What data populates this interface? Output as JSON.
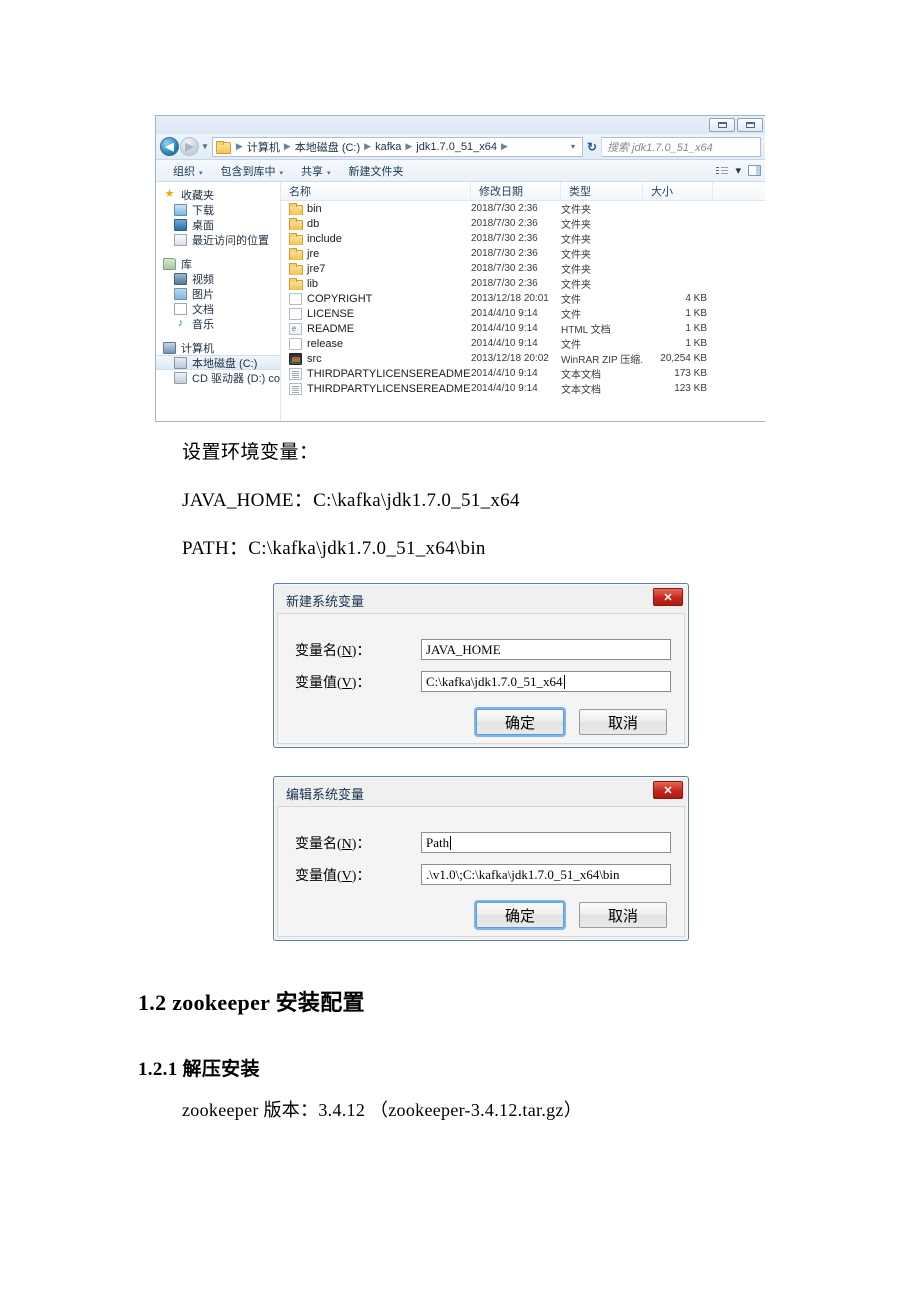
{
  "explorer": {
    "window_buttons": [
      "minimize-button",
      "maximize-button"
    ],
    "address": {
      "back_label": "◀",
      "forward_label": "▶",
      "breadcrumbs": [
        "计算机",
        "本地磁盘 (C:)",
        "kafka",
        "jdk1.7.0_51_x64"
      ],
      "dropdown_label": "▾",
      "refresh_label": "↻",
      "search_placeholder": "搜索 jdk1.7.0_51_x64"
    },
    "toolbar": {
      "items": [
        {
          "label": "组织",
          "caret": "▾"
        },
        {
          "label": "包含到库中",
          "caret": "▾"
        },
        {
          "label": "共享",
          "caret": "▾"
        },
        {
          "label": "新建文件夹",
          "caret": ""
        }
      ],
      "view_caret": "▾"
    },
    "nav": {
      "groups": [
        {
          "header": {
            "label": "收藏夹",
            "icon": "star-icon"
          },
          "children": [
            {
              "label": "下载",
              "icon": "downloads-icon"
            },
            {
              "label": "桌面",
              "icon": "desktop-icon"
            },
            {
              "label": "最近访问的位置",
              "icon": "recent-places-icon"
            }
          ]
        },
        {
          "header": {
            "label": "库",
            "icon": "library-icon"
          },
          "children": [
            {
              "label": "视频",
              "icon": "videos-icon"
            },
            {
              "label": "图片",
              "icon": "pictures-icon"
            },
            {
              "label": "文档",
              "icon": "documents-icon"
            },
            {
              "label": "音乐",
              "icon": "music-icon"
            }
          ]
        },
        {
          "header": {
            "label": "计算机",
            "icon": "computer-icon"
          },
          "children": [
            {
              "label": "本地磁盘 (C:)",
              "icon": "local-disk-icon",
              "selected": true
            },
            {
              "label": "CD 驱动器 (D:) con",
              "icon": "cd-drive-icon"
            }
          ]
        }
      ]
    },
    "columns": [
      "名称",
      "修改日期",
      "类型",
      "大小"
    ],
    "files": [
      {
        "name": "bin",
        "date": "2018/7/30 2:36",
        "type": "文件夹",
        "size": "",
        "icon": "folder-icon"
      },
      {
        "name": "db",
        "date": "2018/7/30 2:36",
        "type": "文件夹",
        "size": "",
        "icon": "folder-icon"
      },
      {
        "name": "include",
        "date": "2018/7/30 2:36",
        "type": "文件夹",
        "size": "",
        "icon": "folder-icon"
      },
      {
        "name": "jre",
        "date": "2018/7/30 2:36",
        "type": "文件夹",
        "size": "",
        "icon": "folder-icon"
      },
      {
        "name": "jre7",
        "date": "2018/7/30 2:36",
        "type": "文件夹",
        "size": "",
        "icon": "folder-icon"
      },
      {
        "name": "lib",
        "date": "2018/7/30 2:36",
        "type": "文件夹",
        "size": "",
        "icon": "folder-icon"
      },
      {
        "name": "COPYRIGHT",
        "date": "2013/12/18 20:01",
        "type": "文件",
        "size": "4 KB",
        "icon": "file-icon"
      },
      {
        "name": "LICENSE",
        "date": "2014/4/10 9:14",
        "type": "文件",
        "size": "1 KB",
        "icon": "file-icon"
      },
      {
        "name": "README",
        "date": "2014/4/10 9:14",
        "type": "HTML 文档",
        "size": "1 KB",
        "icon": "html-file-icon"
      },
      {
        "name": "release",
        "date": "2014/4/10 9:14",
        "type": "文件",
        "size": "1 KB",
        "icon": "file-icon"
      },
      {
        "name": "src",
        "date": "2013/12/18 20:02",
        "type": "WinRAR ZIP 压缩...",
        "size": "20,254 KB",
        "icon": "zip-file-icon"
      },
      {
        "name": "THIRDPARTYLICENSEREADME",
        "date": "2014/4/10 9:14",
        "type": "文本文档",
        "size": "173 KB",
        "icon": "text-file-icon"
      },
      {
        "name": "THIRDPARTYLICENSEREADME-JAVAFX",
        "date": "2014/4/10 9:14",
        "type": "文本文档",
        "size": "123 KB",
        "icon": "text-file-icon"
      }
    ]
  },
  "document": {
    "intro": "设置环境变量：",
    "java_home_line": "JAVA_HOME：C:\\kafka\\jdk1.7.0_51_x64",
    "path_line": "PATH：C:\\kafka\\jdk1.7.0_51_x64\\bin",
    "heading_1_2": "1.2  zookeeper 安装配置",
    "heading_1_2_1": "1.2.1 解压安装",
    "zookeeper_version_line": "zookeeper 版本：3.4.12 （zookeeper-3.4.12.tar.gz）"
  },
  "dialog_new": {
    "title": "新建系统变量",
    "close_label": "✕",
    "name_label_pre": "变量名(",
    "name_label_key": "N",
    "name_label_post": ")：",
    "value_label_pre": "变量值(",
    "value_label_key": "V",
    "value_label_post": ")：",
    "name_value": "JAVA_HOME",
    "value_value": "C:\\kafka\\jdk1.7.0_51_x64",
    "ok_label": "确定",
    "cancel_label": "取消"
  },
  "dialog_edit": {
    "title": "编辑系统变量",
    "close_label": "✕",
    "name_label_pre": "变量名(",
    "name_label_key": "N",
    "name_label_post": ")：",
    "value_label_pre": "变量值(",
    "value_label_key": "V",
    "value_label_post": ")：",
    "name_value": "Path",
    "value_value": ".\\v1.0\\;C:\\kafka\\jdk1.7.0_51_x64\\bin",
    "ok_label": "确定",
    "cancel_label": "取消"
  },
  "colors": {
    "dialog_close_red": "#c5281c",
    "focus_ring_blue": "#7eb4ea",
    "folder_yellow": "#f3c04c"
  }
}
